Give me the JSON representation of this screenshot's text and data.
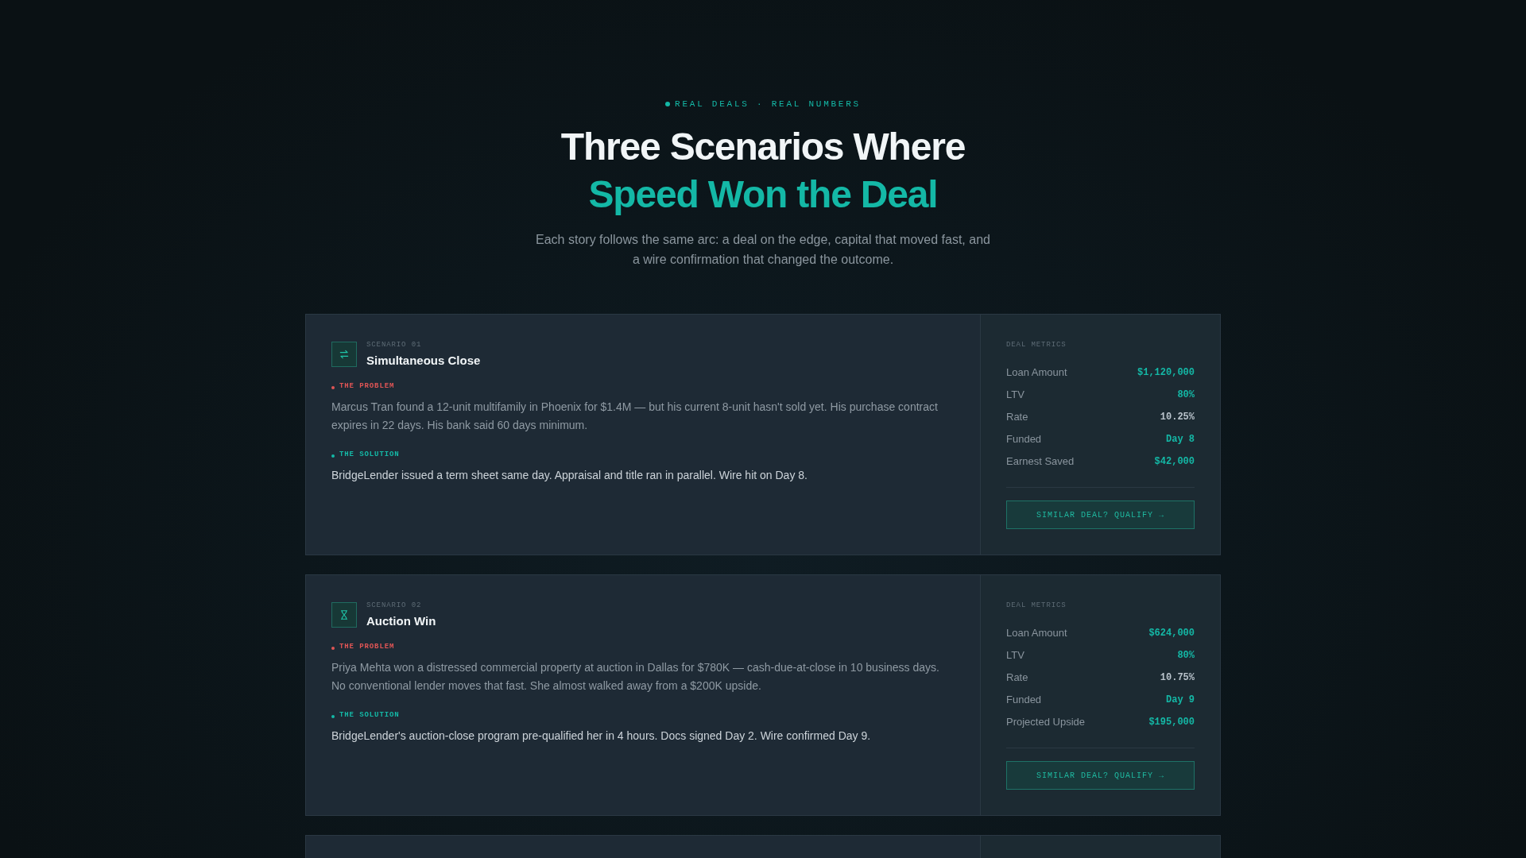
{
  "eyebrow": "REAL DEALS · REAL NUMBERS",
  "heading": "Three Scenarios Where",
  "heading_highlight": "Speed Won the Deal",
  "subtitle": "Each story follows the same arc: a deal on the edge, capital that moved fast, and a wire confirmation that changed the outcome.",
  "scenarios": [
    {
      "number": "SCENARIO 01",
      "title": "Simultaneous Close",
      "problem": {
        "label": "THE PROBLEM",
        "text": "Marcus Tran found a 12-unit multifamily in Phoenix for $1.4M — but his current 8-unit hasn't sold yet. His purchase contract expires in 22 days. His bank said 60 days minimum."
      },
      "solution": {
        "label": "THE SOLUTION",
        "text": "BridgeLender issued a term sheet same day. Appraisal and title ran in parallel. Wire hit on Day 8."
      },
      "metrics_title": "DEAL METRICS",
      "metrics": [
        {
          "label": "Loan Amount",
          "value": "$1,120,000",
          "color": "#14b8a6"
        },
        {
          "label": "LTV",
          "value": "80%",
          "color": "#14b8a6"
        },
        {
          "label": "Rate",
          "value": "10.25%",
          "color": "#b9c3cb"
        },
        {
          "label": "Funded",
          "value": "Day 8",
          "color": "#14b8a6"
        },
        {
          "label": "Earnest Saved",
          "value": "$42,000",
          "color": "#14b8a6"
        }
      ],
      "button": "SIMILAR DEAL? QUALIFY →"
    },
    {
      "number": "SCENARIO 02",
      "title": "Auction Win",
      "problem": {
        "label": "THE PROBLEM",
        "text": "Priya Mehta won a distressed commercial property at auction in Dallas for $780K — cash-due-at-close in 10 business days. No conventional lender moves that fast. She almost walked away from a $200K upside."
      },
      "solution": {
        "label": "THE SOLUTION",
        "text": "BridgeLender's auction-close program pre-qualified her in 4 hours. Docs signed Day 2. Wire confirmed Day 9."
      },
      "metrics_title": "DEAL METRICS",
      "metrics": [
        {
          "label": "Loan Amount",
          "value": "$624,000",
          "color": "#14b8a6"
        },
        {
          "label": "LTV",
          "value": "80%",
          "color": "#14b8a6"
        },
        {
          "label": "Rate",
          "value": "10.75%",
          "color": "#b9c3cb"
        },
        {
          "label": "Funded",
          "value": "Day 9",
          "color": "#14b8a6"
        },
        {
          "label": "Projected Upside",
          "value": "$195,000",
          "color": "#14b8a6"
        }
      ],
      "button": "SIMILAR DEAL? QUALIFY →"
    }
  ]
}
